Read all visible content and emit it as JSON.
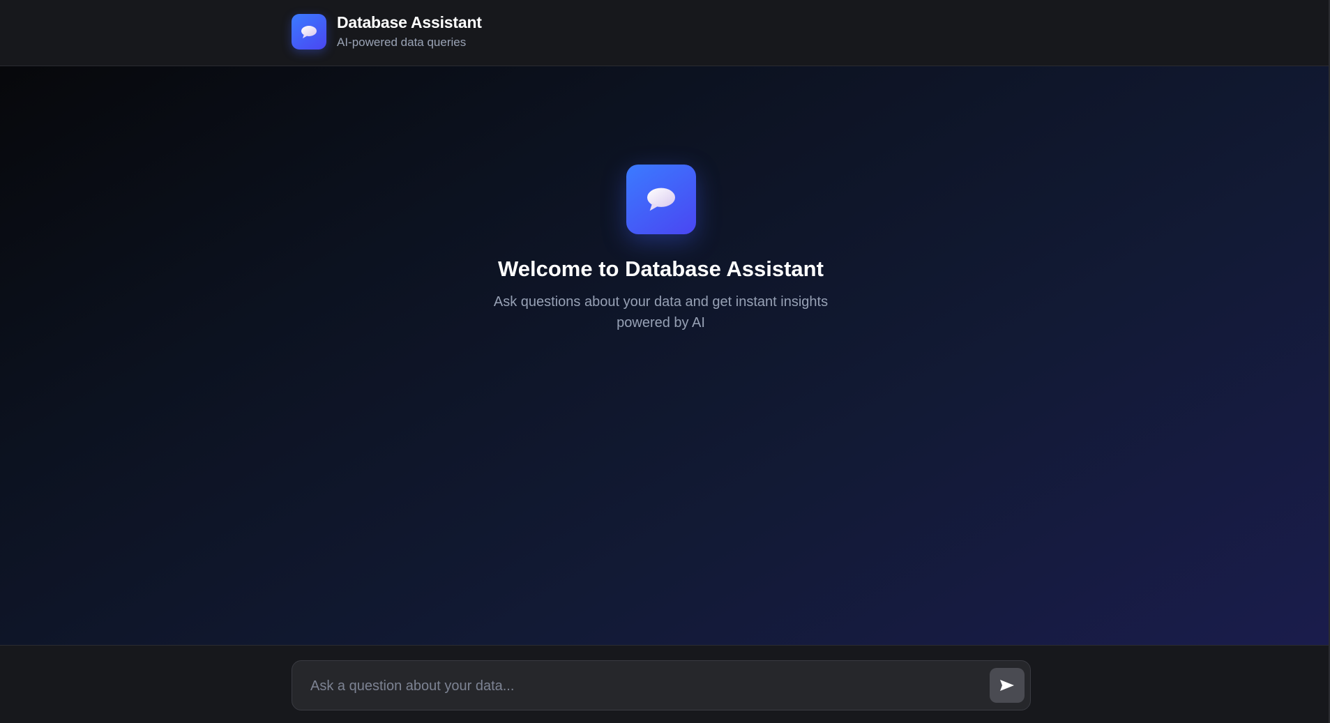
{
  "header": {
    "title": "Database Assistant",
    "subtitle": "AI-powered data queries",
    "logo_icon": "chat-bubble-icon"
  },
  "welcome": {
    "icon": "chat-bubble-icon",
    "title": "Welcome to Database Assistant",
    "description": "Ask questions about your data and get instant insights powered by AI"
  },
  "composer": {
    "value": "",
    "placeholder": "Ask a question about your data...",
    "send_icon": "send-icon"
  },
  "colors": {
    "accent_start": "#3b7bff",
    "accent_end": "#4a46f2",
    "header_bg": "#17181c",
    "input_bg": "#26272b",
    "send_button_bg": "#4a4b52"
  }
}
